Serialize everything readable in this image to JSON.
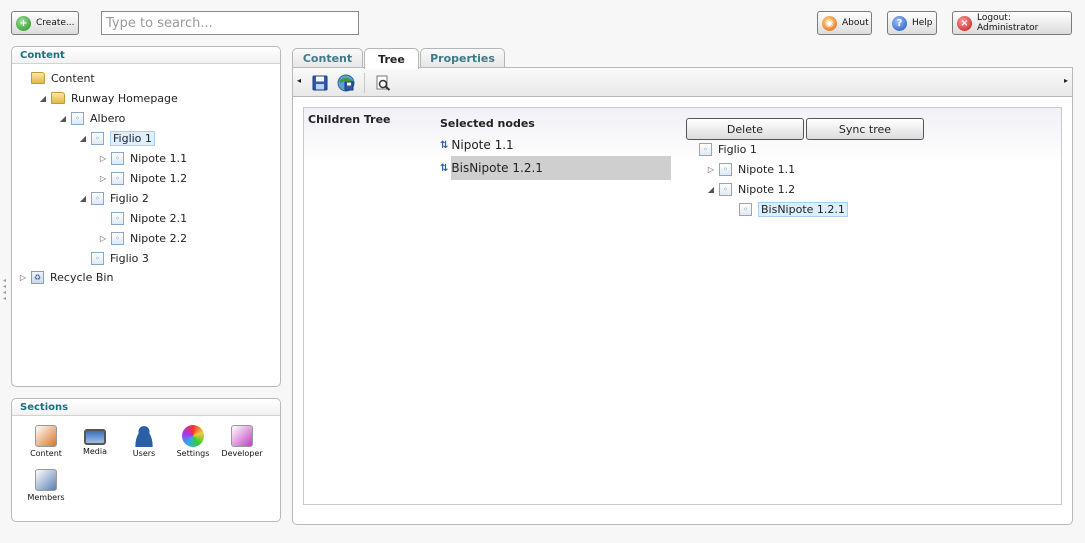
{
  "toolbar": {
    "create_label": "Create...",
    "search_placeholder": "Type to search...",
    "about_label": "About",
    "help_label": "Help",
    "logout_label": "Logout: Administrator"
  },
  "content_panel": {
    "title": "Content",
    "tree": [
      {
        "label": "Content",
        "depth": 0,
        "expander": "none",
        "icon": "folder-icon"
      },
      {
        "label": "Runway Homepage",
        "depth": 1,
        "expander": "expanded",
        "icon": "folder-icon"
      },
      {
        "label": "Albero",
        "depth": 2,
        "expander": "expanded",
        "icon": "document-icon"
      },
      {
        "label": "Figlio 1",
        "depth": 3,
        "expander": "expanded",
        "icon": "document-icon",
        "selected": true
      },
      {
        "label": "Nipote 1.1",
        "depth": 4,
        "expander": "collapsed",
        "icon": "document-icon"
      },
      {
        "label": "Nipote 1.2",
        "depth": 4,
        "expander": "collapsed",
        "icon": "document-icon"
      },
      {
        "label": "Figlio 2",
        "depth": 3,
        "expander": "expanded",
        "icon": "document-icon"
      },
      {
        "label": "Nipote 2.1",
        "depth": 4,
        "expander": "none",
        "icon": "document-icon"
      },
      {
        "label": "Nipote 2.2",
        "depth": 4,
        "expander": "collapsed",
        "icon": "document-icon"
      },
      {
        "label": "Figlio 3",
        "depth": 3,
        "expander": "none",
        "icon": "document-icon"
      },
      {
        "label": "Recycle Bin",
        "depth": 0,
        "expander": "collapsed",
        "icon": "recycle-bin-icon"
      }
    ]
  },
  "sections_panel": {
    "title": "Sections",
    "items": [
      {
        "label": "Content",
        "icon": "pencil-icon",
        "color": "#d9732b"
      },
      {
        "label": "Media",
        "icon": "monitor-icon",
        "color": "#3c6fb4"
      },
      {
        "label": "Users",
        "icon": "user-icon",
        "color": "#2a5fa8"
      },
      {
        "label": "Settings",
        "icon": "color-wheel-icon",
        "color": "#e0b020"
      },
      {
        "label": "Developer",
        "icon": "magic-wand-icon",
        "color": "#c040c0"
      },
      {
        "label": "Members",
        "icon": "member-card-icon",
        "color": "#5a7fb0"
      }
    ]
  },
  "tabs": [
    {
      "label": "Content",
      "active": false
    },
    {
      "label": "Tree",
      "active": true
    },
    {
      "label": "Properties",
      "active": false
    }
  ],
  "editor_toolbar": {
    "icons": [
      "save-icon",
      "save-publish-icon",
      "preview-icon"
    ]
  },
  "children_tree": {
    "label": "Children Tree",
    "selected_nodes_label": "Selected nodes",
    "selected_nodes": [
      "Nipote 1.1",
      "BisNipote 1.2.1"
    ],
    "delete_label": "Delete",
    "sync_label": "Sync tree",
    "tree": [
      {
        "label": "Figlio 1",
        "depth": 0,
        "expander": "none"
      },
      {
        "label": "Nipote 1.1",
        "depth": 1,
        "expander": "collapsed"
      },
      {
        "label": "Nipote 1.2",
        "depth": 1,
        "expander": "expanded"
      },
      {
        "label": "BisNipote 1.2.1",
        "depth": 2,
        "expander": "none",
        "selected": true
      }
    ]
  }
}
